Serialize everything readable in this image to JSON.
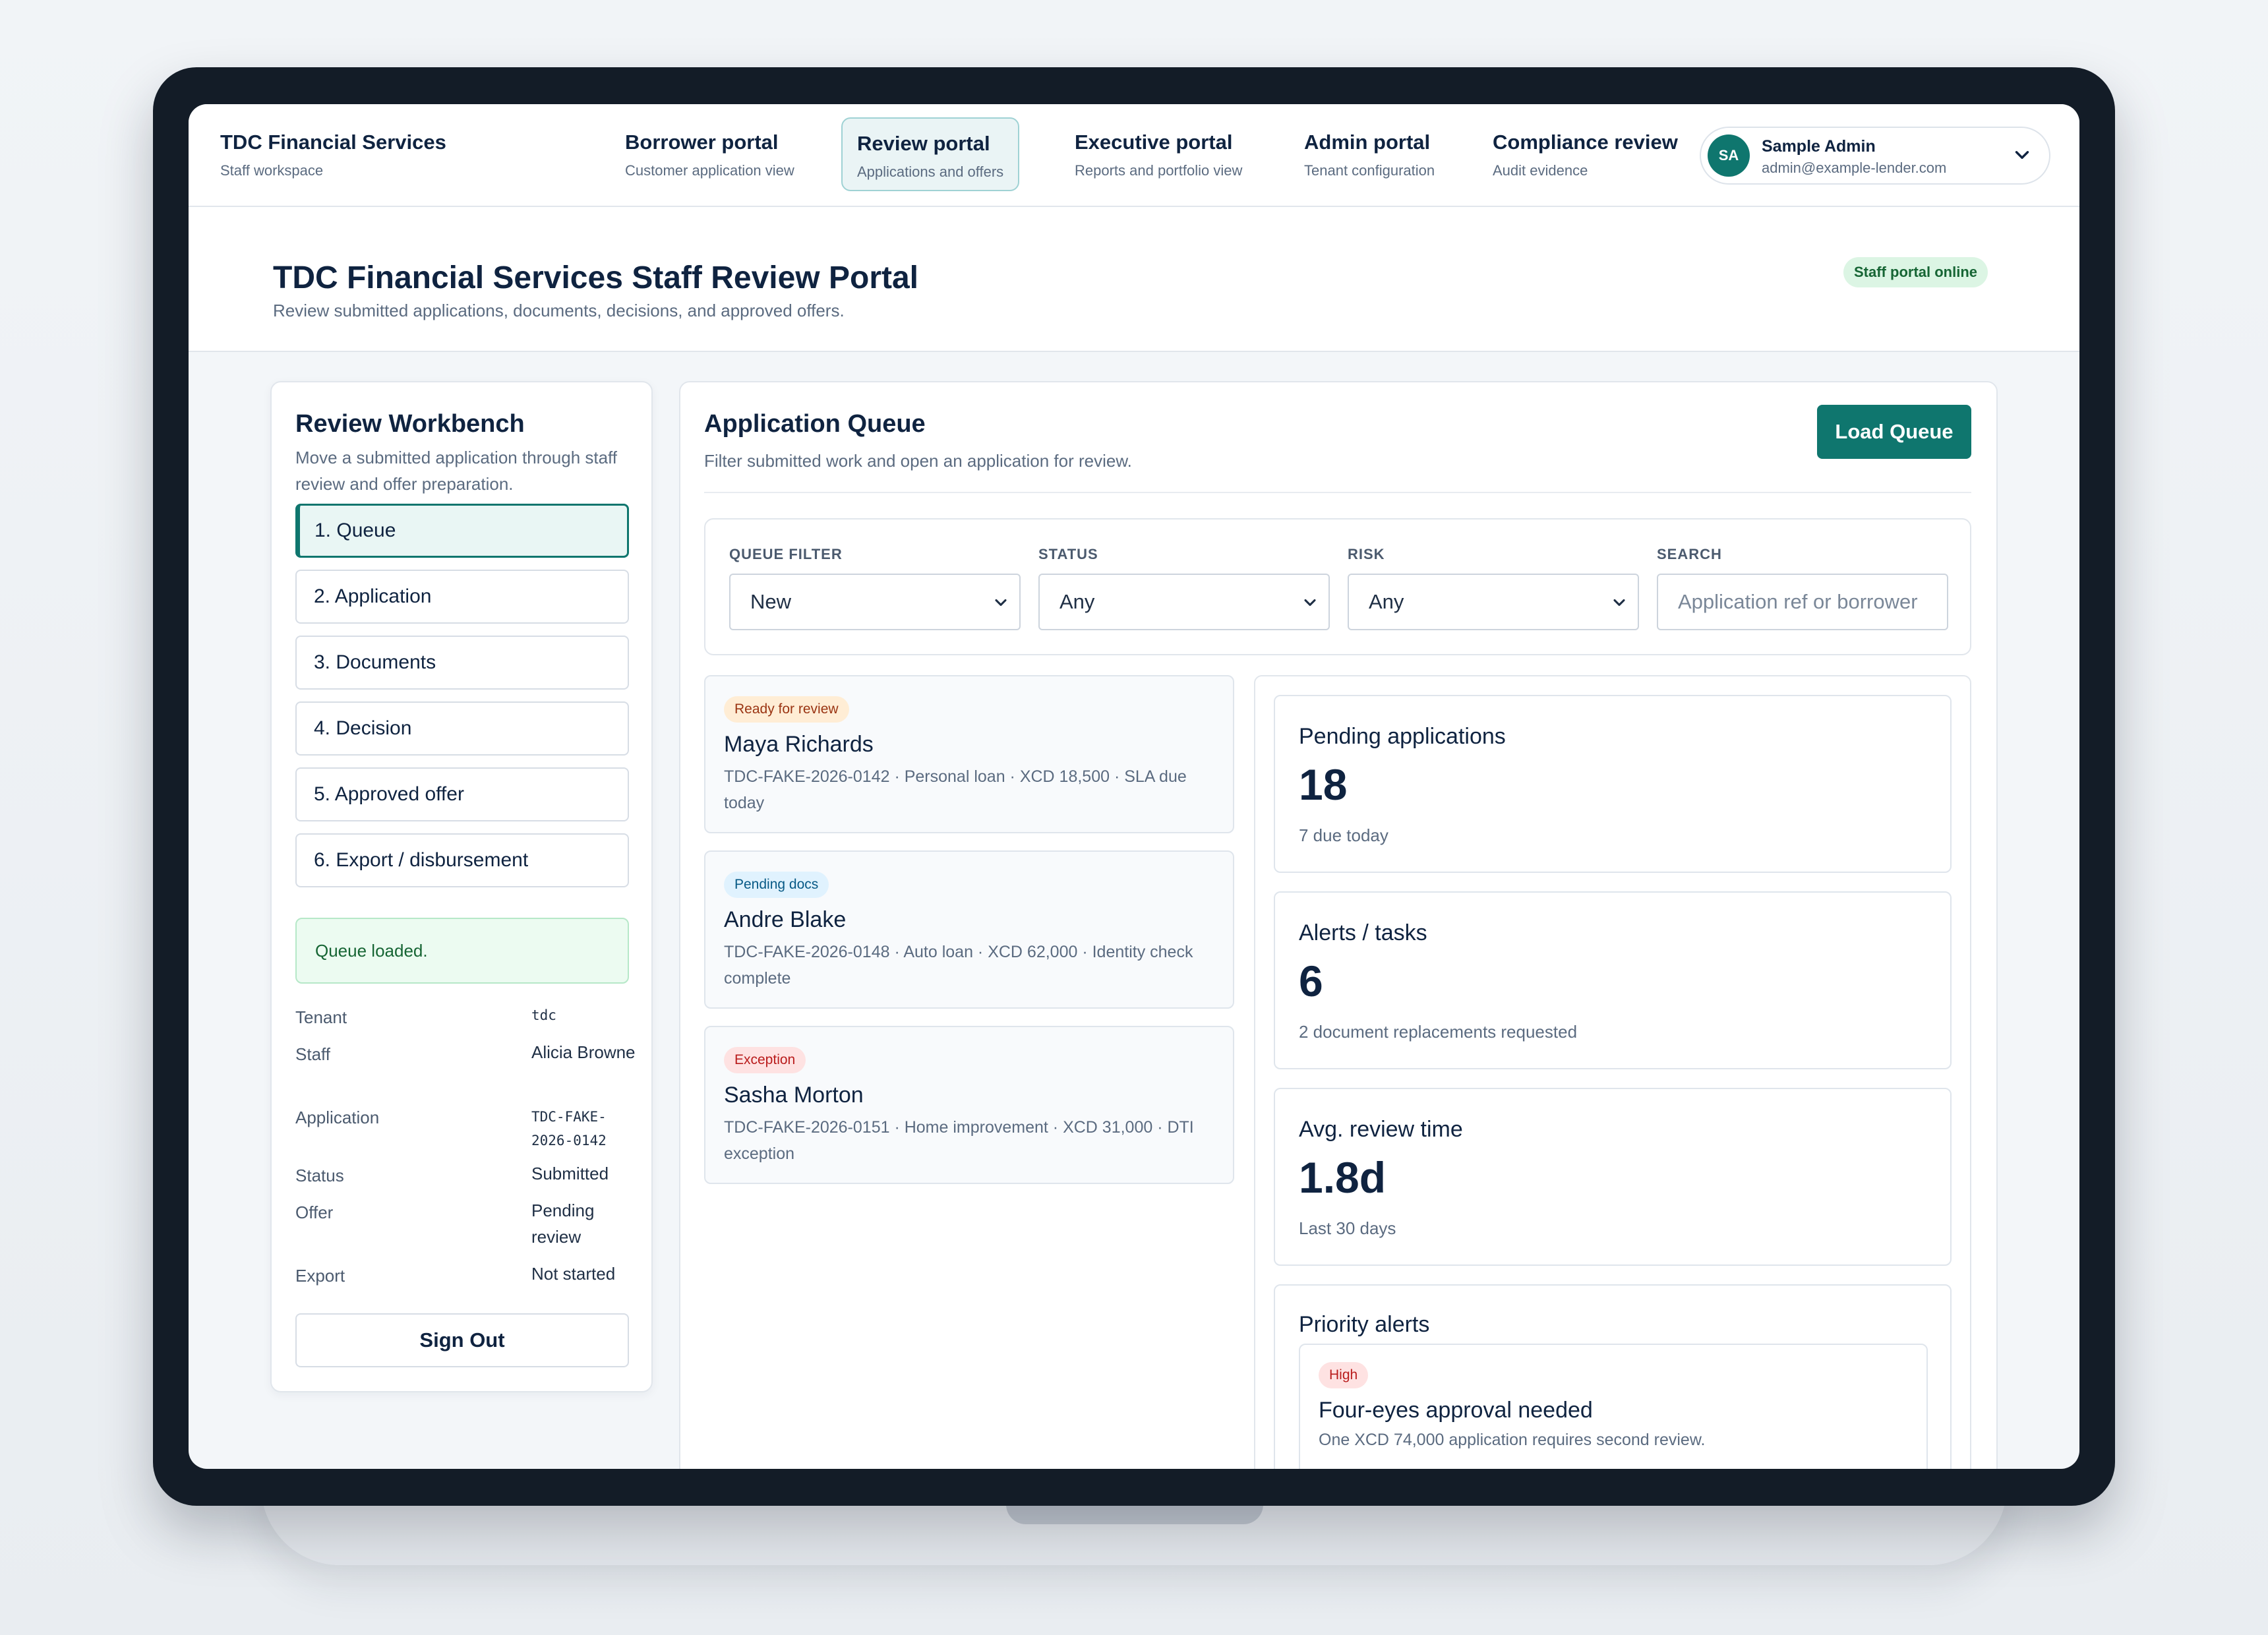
{
  "nav": {
    "brand": {
      "title": "TDC Financial Services",
      "subtitle": "Staff workspace"
    },
    "tabs": [
      {
        "title": "Borrower portal",
        "subtitle": "Customer application view"
      },
      {
        "title": "Review portal",
        "subtitle": "Applications and offers"
      },
      {
        "title": "Executive portal",
        "subtitle": "Reports and portfolio view"
      },
      {
        "title": "Admin portal",
        "subtitle": "Tenant configuration"
      },
      {
        "title": "Compliance review",
        "subtitle": "Audit evidence"
      }
    ],
    "user": {
      "initials": "SA",
      "name": "Sample Admin",
      "email": "admin@example-lender.com"
    }
  },
  "header": {
    "title": "TDC Financial Services Staff Review Portal",
    "subtitle": "Review submitted applications, documents, decisions, and approved offers.",
    "status_badge": "Staff portal online"
  },
  "workbench": {
    "title": "Review Workbench",
    "description": "Move a submitted application through staff review and offer preparation.",
    "steps": [
      "1. Queue",
      "2. Application",
      "3. Documents",
      "4. Decision",
      "5. Approved offer",
      "6. Export / disbursement"
    ],
    "message": "Queue loaded.",
    "details": [
      {
        "label": "Tenant",
        "value": "tdc"
      },
      {
        "label": "Staff",
        "value": "Alicia Browne"
      },
      {
        "label": "Application",
        "value": "TDC-FAKE-2026-0142"
      },
      {
        "label": "Status",
        "value": "Submitted"
      },
      {
        "label": "Offer",
        "value": "Pending review"
      },
      {
        "label": "Export",
        "value": "Not started"
      }
    ],
    "sign_out": "Sign Out"
  },
  "queue": {
    "title": "Application Queue",
    "description": "Filter submitted work and open an application for review.",
    "load_button": "Load Queue",
    "filters": [
      {
        "label": "QUEUE FILTER",
        "value": "New"
      },
      {
        "label": "STATUS",
        "value": "Any"
      },
      {
        "label": "RISK",
        "value": "Any"
      },
      {
        "label": "SEARCH",
        "placeholder": "Application ref or borrower"
      }
    ],
    "applications": [
      {
        "badge": "Ready for review",
        "name": "Maya Richards",
        "meta": "TDC-FAKE-2026-0142 · Personal loan · XCD 18,500 · SLA due today"
      },
      {
        "badge": "Pending docs",
        "name": "Andre Blake",
        "meta": "TDC-FAKE-2026-0148 · Auto loan · XCD 62,000 · Identity check complete"
      },
      {
        "badge": "Exception",
        "name": "Sasha Morton",
        "meta": "TDC-FAKE-2026-0151 · Home improvement · XCD 31,000 · DTI exception"
      }
    ]
  },
  "stats": [
    {
      "label": "Pending applications",
      "value": "18",
      "note": "7 due today"
    },
    {
      "label": "Alerts / tasks",
      "value": "6",
      "note": "2 document replacements requested"
    },
    {
      "label": "Avg. review time",
      "value": "1.8d",
      "note": "Last 30 days"
    }
  ],
  "priority_alerts": {
    "title": "Priority alerts",
    "items": [
      {
        "badge": "High",
        "title": "Four-eyes approval needed",
        "detail": "One XCD 74,000 application requires second review."
      }
    ]
  }
}
